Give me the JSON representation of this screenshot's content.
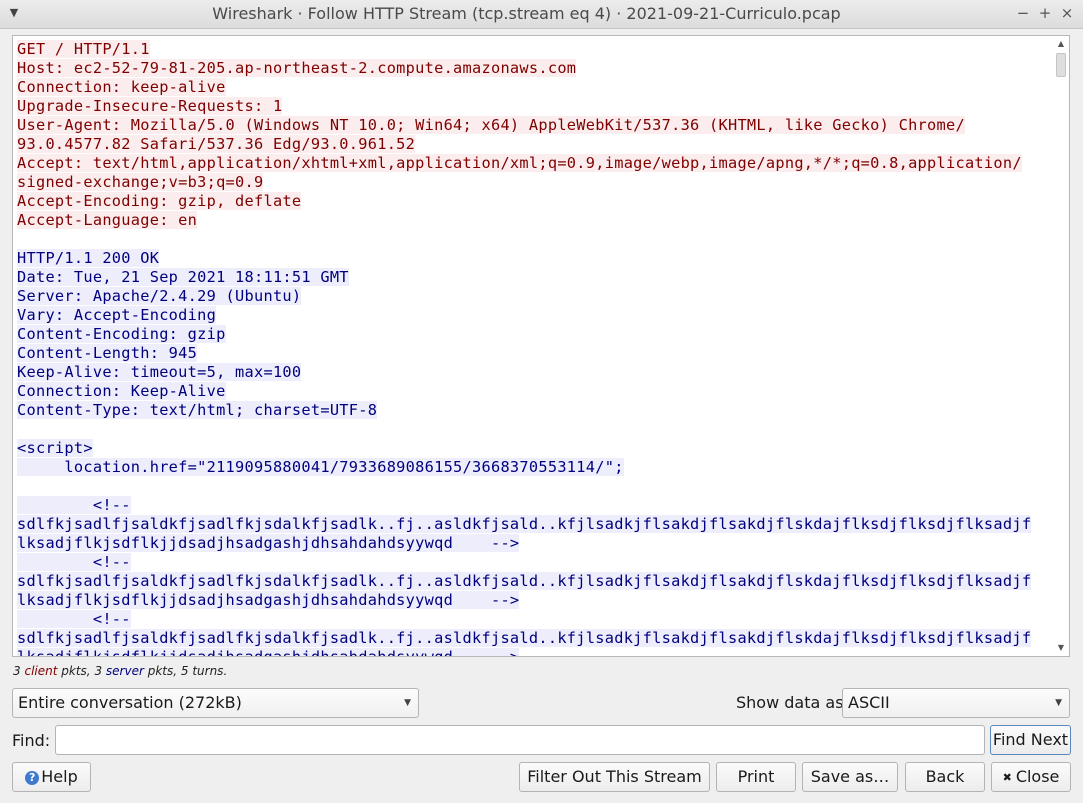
{
  "window": {
    "title": "Wireshark · Follow HTTP Stream (tcp.stream eq 4) · 2021-09-21-Curriculo.pcap",
    "menu_icon": "chevron-down-icon",
    "minimize": "−",
    "maximize": "+",
    "close": "×"
  },
  "stream": {
    "client_lines": [
      "GET / HTTP/1.1",
      "Host: ec2-52-79-81-205.ap-northeast-2.compute.amazonaws.com",
      "Connection: keep-alive",
      "Upgrade-Insecure-Requests: 1",
      "User-Agent: Mozilla/5.0 (Windows NT 10.0; Win64; x64) AppleWebKit/537.36 (KHTML, like Gecko) Chrome/",
      "93.0.4577.82 Safari/537.36 Edg/93.0.961.52",
      "Accept: text/html,application/xhtml+xml,application/xml;q=0.9,image/webp,image/apng,*/*;q=0.8,application/",
      "signed-exchange;v=b3;q=0.9",
      "Accept-Encoding: gzip, deflate",
      "Accept-Language: en"
    ],
    "server_lines": [
      "HTTP/1.1 200 OK",
      "Date: Tue, 21 Sep 2021 18:11:51 GMT",
      "Server: Apache/2.4.29 (Ubuntu)",
      "Vary: Accept-Encoding",
      "Content-Encoding: gzip",
      "Content-Length: 945",
      "Keep-Alive: timeout=5, max=100",
      "Connection: Keep-Alive",
      "Content-Type: text/html; charset=UTF-8",
      "",
      "<script>",
      "     location.href=\"2119095880041/7933689086155/3668370553114/\";",
      "",
      "        <!--",
      "sdlfkjsadlfjsaldkfjsadlfkjsdalkfjsadlk..fj..asldkfjsald..kfjlsadkjflsakdjflsakdjflskdajflksdjflksdjflksadjf",
      "lksadjflkjsdflkjjdsadjhsadgashjdhsahdahdsyywqd    -->",
      "        <!--",
      "sdlfkjsadlfjsaldkfjsadlfkjsdalkfjsadlk..fj..asldkfjsald..kfjlsadkjflsakdjflsakdjflskdajflksdjflksdjflksadjf",
      "lksadjflkjsdflkjjdsadjhsadgashjdhsahdahdsyywqd    -->",
      "        <!--",
      "sdlfkjsadlfjsaldkfjsadlfkjsdalkfjsadlk..fj..asldkfjsald..kfjlsadkjflsakdjflsakdjflskdajflksdjflksdjflksadjf",
      "lksadjflkjsdflkjjdsadjhsadgashjdhsahdahdsyywqd    -->"
    ]
  },
  "stats": {
    "client_count": "3",
    "client_word": "client",
    "middle": "pkts,",
    "server_count": "3",
    "server_word": "server",
    "tail": "pkts, 5 turns."
  },
  "conversation_select": {
    "value": "Entire conversation (272kB)"
  },
  "show_data": {
    "label": "Show data as",
    "value": "ASCII"
  },
  "find": {
    "label": "Find:",
    "value": "",
    "button": "Find Next"
  },
  "buttons": {
    "help": "Help",
    "help_icon": "help-circle-icon",
    "filter_out": "Filter Out This Stream",
    "print": "Print",
    "save_as": "Save as…",
    "back": "Back",
    "close": "Close",
    "close_icon": "close-x-icon"
  },
  "colors": {
    "client_text": "#7f0000",
    "client_bg": "#fbeded",
    "server_text": "#00007f",
    "server_bg": "#ededfb"
  }
}
